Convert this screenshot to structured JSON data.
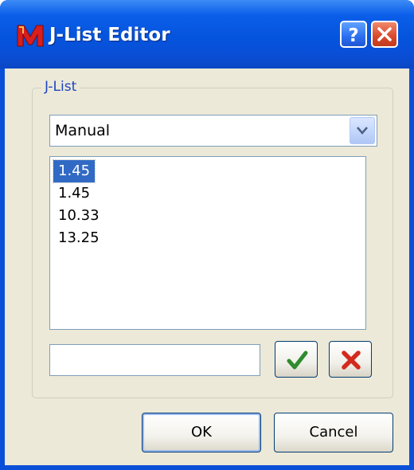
{
  "window": {
    "title": "J-List Editor",
    "app_icon": "m-logo-icon",
    "help_icon": "question-mark-icon",
    "close_icon": "close-x-icon"
  },
  "group": {
    "label": "J-List"
  },
  "mode_select": {
    "selected": "Manual",
    "icon": "chevron-down-icon"
  },
  "list": {
    "items": [
      "1.45",
      "1.45",
      "10.33",
      "13.25"
    ],
    "selected_index": 0
  },
  "entry": {
    "value": ""
  },
  "actions": {
    "apply_icon": "green-checkmark-icon",
    "remove_icon": "red-x-icon"
  },
  "buttons": {
    "ok": "OK",
    "cancel": "Cancel"
  },
  "colors": {
    "titlebar": "#0554dd",
    "client_bg": "#ece9d8",
    "selection": "#316ac5",
    "group_label": "#1f44c2",
    "check": "#2e8b2e",
    "cross": "#d42a1e"
  }
}
